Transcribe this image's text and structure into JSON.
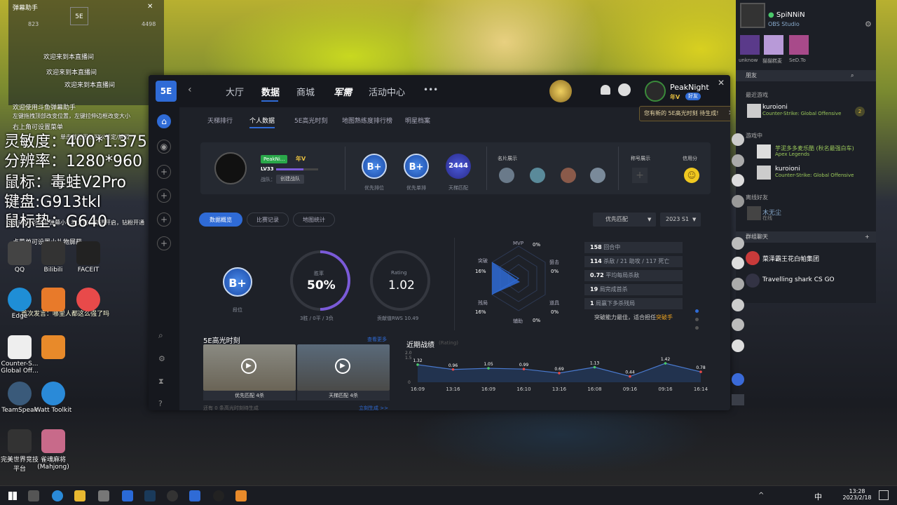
{
  "overlay": {
    "line1": "灵敏度：400*1.375",
    "line2": "分辨率：1280*960",
    "line3": "鼠标：毒蛙V2Pro",
    "line4": "键盘:G913tkl",
    "line5": "鼠标垫：G640"
  },
  "chat": {
    "title": "弹幕助手",
    "count1": "823",
    "count2": "4498",
    "lines": [
      "欢迎来到本直播间",
      "欢迎来到本直播间",
      "欢迎来到本直播间",
      "欢迎使用斗鱼弹幕助手",
      "左键拖拽顶部改变位置，左键拉伸边框改变大小",
      "右上角可设置菜单",
      "单击截图图标可以锁定/解锁",
      "鼠标滑轮可调节弹幕小礼物，窗口穿透开启，钻粉开通",
      "点菜单可设置小礼物屏蔽",
      "首次发言：哪里人都这么强了吗"
    ]
  },
  "desktop": {
    "icons": [
      "Counter-S... Global Off...",
      "TeamSpeak",
      "Watt Toolkit",
      "完美世界竞技平台",
      "雀魂麻将 (Mahjong)",
      "QQ",
      "Bilibili",
      "FACEIT",
      "Edge"
    ]
  },
  "app": {
    "logo": "5E",
    "nav": [
      "大厅",
      "数据",
      "商城",
      "军需",
      "活动中心"
    ],
    "more": "•••",
    "user": {
      "name": "PeakNight",
      "level_badge": "年V",
      "status": "好友"
    },
    "notify": "您有新的 5E高光时刻 待生成!",
    "subtabs": [
      "天梯排行",
      "个人数据",
      "5E高光时刻",
      "地图熟练度排行榜",
      "明星档案"
    ],
    "profile": {
      "name_tag": "PeakNi...",
      "vip": "年V",
      "level": "LV33",
      "team_label": "战队：",
      "team_btn": "创建战队",
      "ranks": [
        {
          "badge": "B+",
          "label": "优先排位"
        },
        {
          "badge": "B+",
          "label": "优先单排"
        },
        {
          "badge": "2444",
          "label": "天梯匹配"
        }
      ],
      "card_title": "名片展示",
      "title_show": "称号展示",
      "credit": "信用分"
    },
    "pills": [
      "数据概览",
      "比赛记录",
      "地图统计"
    ],
    "mode_select": "优先匹配",
    "season_select": "2023 S1",
    "stats": {
      "rank": "B+",
      "rank_label": "段位",
      "winrate_label": "胜率",
      "winrate": "50%",
      "winrate_sub": "3胜 / 0平 / 3负",
      "rating_label": "Rating",
      "rating": "1.02",
      "rating_sub": "贡献值RWS 10.49"
    },
    "radar": {
      "labels": [
        {
          "name": "MVP",
          "value": "0%"
        },
        {
          "name": "突破",
          "value": "16%"
        },
        {
          "name": "狙击",
          "value": "0%"
        },
        {
          "name": "残局",
          "value": "16%"
        },
        {
          "name": "辅助",
          "value": "0%"
        },
        {
          "name": "道具",
          "value": "0%"
        }
      ]
    },
    "statlist": [
      {
        "num": "158",
        "text": "回合中"
      },
      {
        "num": "114",
        "text": "杀敌 / 21 助攻 / 117 死亡"
      },
      {
        "num": "0.72",
        "text": "平均每局杀敌"
      },
      {
        "num": "19",
        "text": "局完成首杀"
      },
      {
        "num": "1",
        "text": "局赢下多杀残局"
      }
    ],
    "statnote": "突破能力最佳，适合担任",
    "statnote_role": "突破手",
    "highlights": {
      "title": "5E高光时刻",
      "more": "查看更多",
      "items": [
        "优先匹配 4杀",
        "天梯匹配 4杀"
      ],
      "footer": "还有 0 条高光时刻待生成",
      "generate": "立刻生成 >>"
    },
    "recent": {
      "title": "近期战绩",
      "sub": "(Rating)",
      "ymax": "2.0",
      "ymid": "1.5",
      "ymin": "0"
    }
  },
  "chart_data": {
    "type": "line",
    "title": "近期战绩",
    "ylabel": "Rating",
    "categories": [
      "16:09",
      "13:16",
      "16:09",
      "16:10",
      "13:16",
      "16:08",
      "09:16",
      "09:16",
      "16:14"
    ],
    "values": [
      1.32,
      0.96,
      1.05,
      0.99,
      0.69,
      1.13,
      0.44,
      1.42,
      0.78
    ],
    "ylim": [
      0,
      2.0
    ]
  },
  "rpanel": {
    "user": "SpiNNiN",
    "app": "OBS Studio",
    "games": [
      "unknow",
      "猫猫糕麦",
      "SeD.To"
    ],
    "sections": [
      "朋友",
      "最近游戏",
      "游戏中",
      "离线好友",
      "群组聊天"
    ],
    "friends": [
      {
        "name": "kuroioni",
        "game": "Counter-Strike: Global Offensive",
        "count": "2"
      },
      {
        "name": "芋泥多多麦乐酷 (秋名最强白车)",
        "game": "Apex Legends"
      },
      {
        "name": "kuroioni",
        "game": "Counter-Strike: Global Offensive"
      },
      {
        "name": "木无尘",
        "game": "在线"
      }
    ],
    "groups": [
      "菜泽霸王花白帕集团",
      "Travelling shark CS GO"
    ]
  },
  "taskbar": {
    "time": "13:28",
    "date": "2023/2/18",
    "ime": "中"
  },
  "colors": {
    "accent": "#2f6bd6",
    "app_bg": "#1e2128",
    "radar_fill": "#2f6bd6",
    "chart_line": "#4a7acf"
  }
}
